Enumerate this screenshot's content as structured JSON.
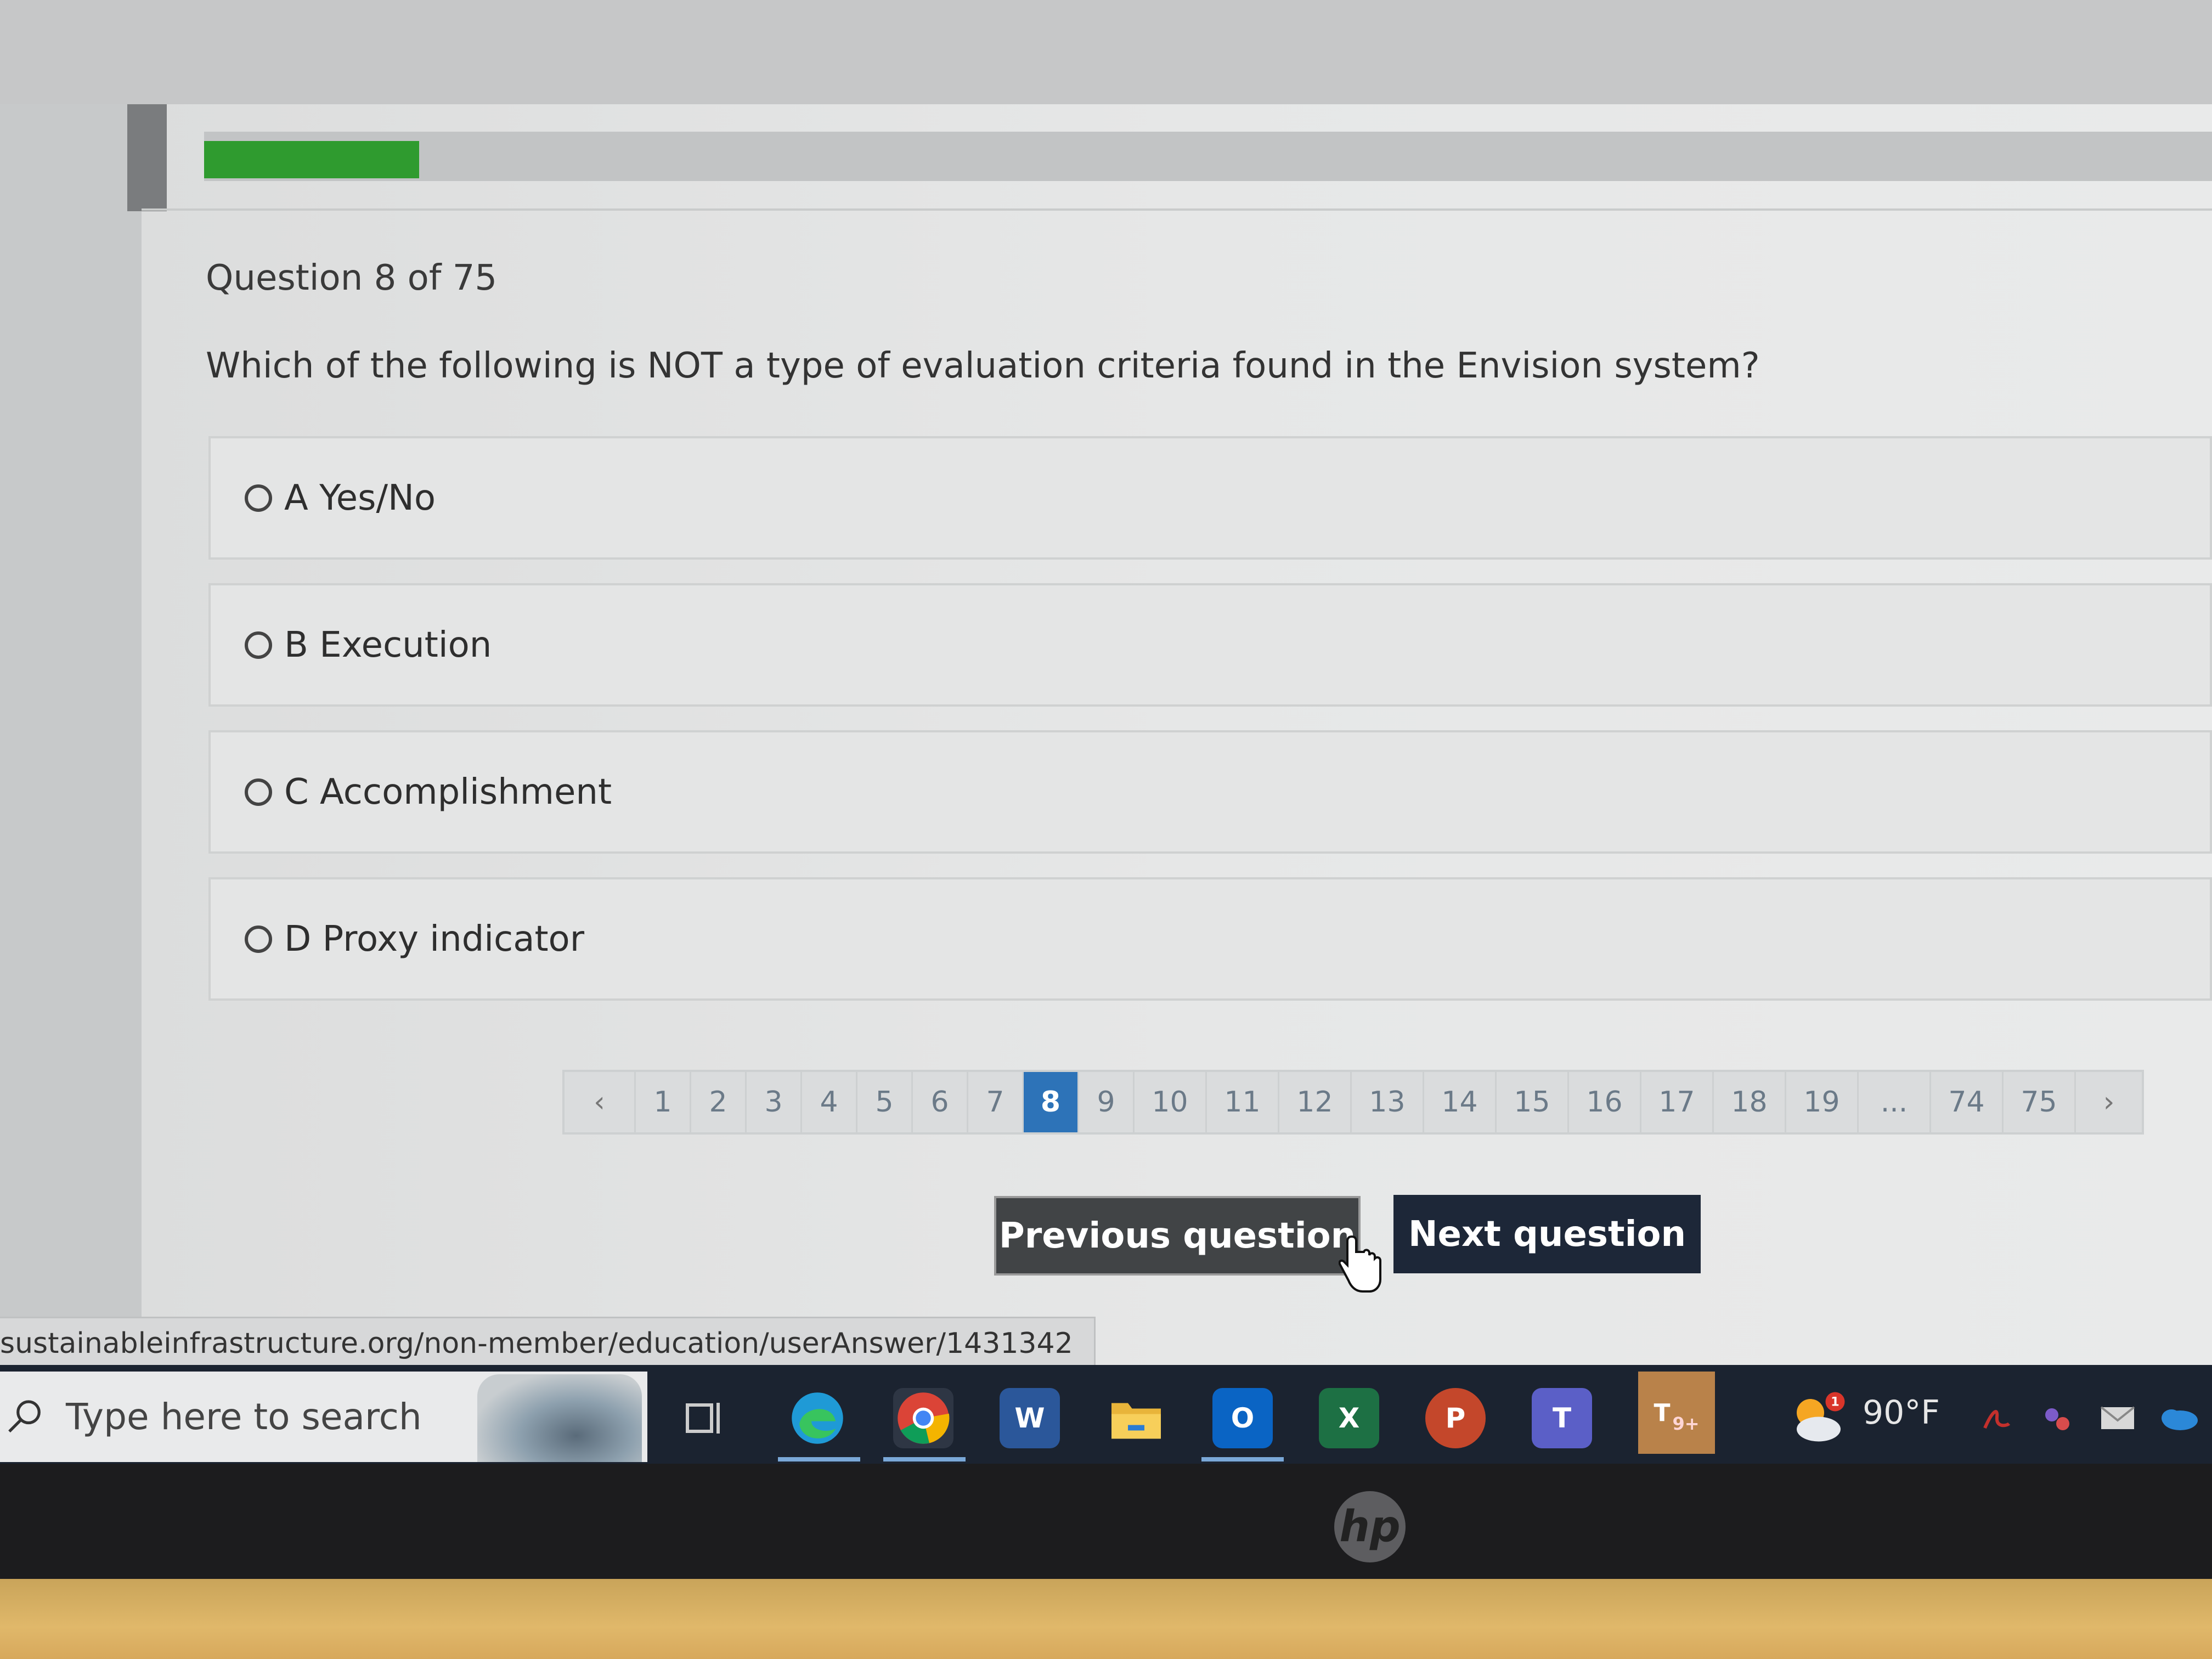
{
  "quiz": {
    "progress_fraction": 0.107,
    "question_counter": "Question 8 of 75",
    "question_text": "Which of the following is NOT a type of evaluation criteria found in the Envision system?",
    "options": [
      {
        "label": "A Yes/No"
      },
      {
        "label": "B Execution"
      },
      {
        "label": "C Accomplishment"
      },
      {
        "label": "D Proxy indicator"
      }
    ]
  },
  "pagination": {
    "prev_symbol": "‹",
    "next_symbol": "›",
    "pages": [
      "1",
      "2",
      "3",
      "4",
      "5",
      "6",
      "7",
      "8",
      "9",
      "10",
      "11",
      "12",
      "13",
      "14",
      "15",
      "16",
      "17",
      "18",
      "19",
      "...",
      "74",
      "75"
    ],
    "current_page": "8"
  },
  "buttons": {
    "previous_label": "Previous question",
    "next_label": "Next question"
  },
  "status_bar": {
    "url": "sustainableinfrastructure.org/non-member/education/userAnswer/1431342"
  },
  "taskbar": {
    "search_placeholder": "Type here to search",
    "apps": [
      {
        "name": "task-view-icon"
      },
      {
        "name": "edge-icon"
      },
      {
        "name": "chrome-icon"
      },
      {
        "name": "word-icon",
        "glyph": "W",
        "color": "#2b579a"
      },
      {
        "name": "file-explorer-icon"
      },
      {
        "name": "outlook-icon",
        "glyph": "O",
        "color": "#0a64c4"
      },
      {
        "name": "excel-icon",
        "glyph": "X",
        "color": "#1d7044"
      },
      {
        "name": "powerpoint-icon",
        "glyph": "P",
        "color": "#c4472b"
      },
      {
        "name": "teams-icon",
        "glyph": "T",
        "color": "#5b5fc7"
      },
      {
        "name": "teams-notification-icon",
        "glyph": "T",
        "color": "#5b5fc7",
        "badge": "9+"
      }
    ],
    "weather_badge": "1",
    "weather_temp": "90°F"
  },
  "device": {
    "brand_logo": "hp"
  }
}
